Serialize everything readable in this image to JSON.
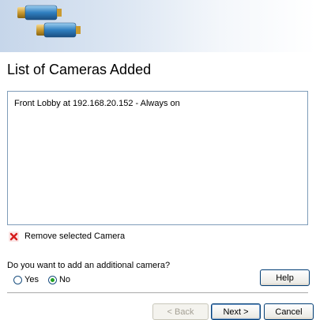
{
  "header": {
    "icon": "camera-icon"
  },
  "page": {
    "title": "List of Cameras Added"
  },
  "cameras": {
    "items": [
      "Front Lobby at 192.168.20.152 - Always on"
    ]
  },
  "actions": {
    "remove_label": "Remove selected Camera",
    "remove_icon": "red-x-icon"
  },
  "question": {
    "text": "Do you want to add an additional camera?",
    "options": [
      {
        "label": "Yes",
        "selected": false
      },
      {
        "label": "No",
        "selected": true
      }
    ]
  },
  "buttons": {
    "help": "Help",
    "back": "< Back",
    "next": "Next >",
    "cancel": "Cancel"
  }
}
